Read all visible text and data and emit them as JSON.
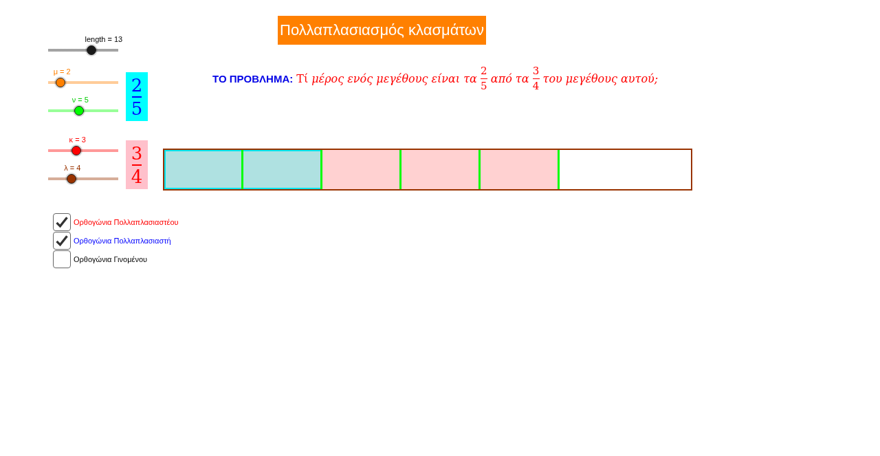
{
  "title": "Πολλαπλασιασμός κλασμάτων",
  "length_slider": {
    "label": "length = 13",
    "level": 0.62,
    "color": "#1a1a1a"
  },
  "groups": [
    {
      "kind": "multiplier",
      "sliders": [
        {
          "label": "μ = 2",
          "level": 0.18,
          "color": "#ff8000"
        },
        {
          "label": "ν = 5",
          "level": 0.44,
          "color": "#00ff00"
        }
      ],
      "fraction": {
        "numerator": "2",
        "denominator": "5"
      }
    },
    {
      "kind": "multiplicand",
      "sliders": [
        {
          "label": "κ = 3",
          "level": 0.4,
          "color": "#ff0000"
        },
        {
          "label": "λ = 4",
          "level": 0.33,
          "color": "#993300"
        }
      ],
      "fraction": {
        "numerator": "3",
        "denominator": "4"
      }
    }
  ],
  "problem": {
    "label": "ΤΟ ΠΡΟΒΛΗΜΑ:",
    "parts": [
      {
        "kind": "text",
        "text": "Τί"
      },
      {
        "kind": "italic",
        "text": "μέρος ενός μεγέθους είναι τα"
      },
      {
        "kind": "fraction",
        "numerator": "2",
        "denominator": "5"
      },
      {
        "kind": "italic",
        "text": "από τα"
      },
      {
        "kind": "fraction",
        "numerator": "3",
        "denominator": "4"
      },
      {
        "kind": "italic",
        "text": "του μεγέθους αυτού;"
      }
    ]
  },
  "bar": {
    "level": 0.75,
    "segments": [
      {
        "color": "#afe1e1",
        "outlined": true
      },
      {
        "color": "#afe1e1",
        "outlined": true
      },
      {
        "color": "#ffd1d1",
        "outlined": false
      },
      {
        "color": "#ffd1d1",
        "outlined": false
      },
      {
        "color": "#ffd1d1",
        "outlined": false
      }
    ]
  },
  "checkboxes": [
    {
      "label": "Ορθογώνια Πολλαπλασιαστέου",
      "checked": true,
      "color": "#ff0000"
    },
    {
      "label": "Ορθογώνια Πολλαπλασιαστή",
      "checked": true,
      "color": "#0000ff"
    },
    {
      "label": "Ορθογώνια Γινομένου",
      "checked": false,
      "color": "#000000"
    }
  ]
}
